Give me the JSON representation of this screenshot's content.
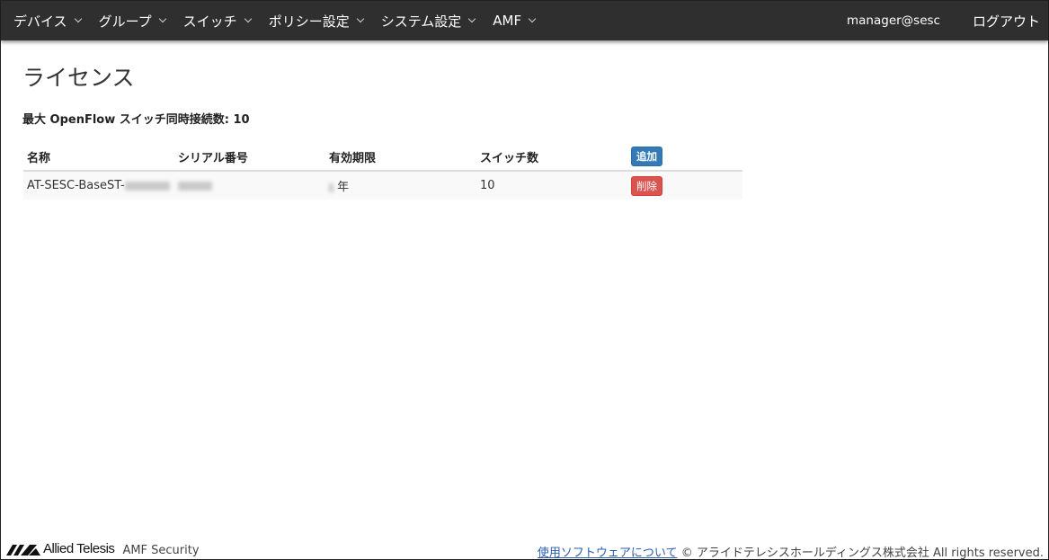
{
  "nav": {
    "items": [
      {
        "label": "デバイス"
      },
      {
        "label": "グループ"
      },
      {
        "label": "スイッチ"
      },
      {
        "label": "ポリシー設定"
      },
      {
        "label": "システム設定"
      },
      {
        "label": "AMF"
      }
    ],
    "user": "manager@sesc",
    "logout": "ログアウト"
  },
  "page": {
    "title": "ライセンス",
    "max_connections": "最大 OpenFlow スイッチ同時接続数: 10"
  },
  "table": {
    "headers": {
      "name": "名称",
      "serial": "シリアル番号",
      "validity": "有効期限",
      "switches": "スイッチ数"
    },
    "add_label": "追加",
    "rows": [
      {
        "name": "AT-SESC-BaseST-",
        "validity_unit": "年",
        "switches": "10",
        "delete_label": "削除"
      }
    ]
  },
  "footer": {
    "brand": "Allied Telesis",
    "product": "AMF Security",
    "link": "使用ソフトウェアについて",
    "copyright": "© アライドテレシスホールディングス株式会社 All rights reserved."
  },
  "colors": {
    "navbar_bg": "#2f2f2f",
    "add_button": "#337ab7",
    "delete_button": "#d9534f",
    "link": "#2a5db0"
  }
}
